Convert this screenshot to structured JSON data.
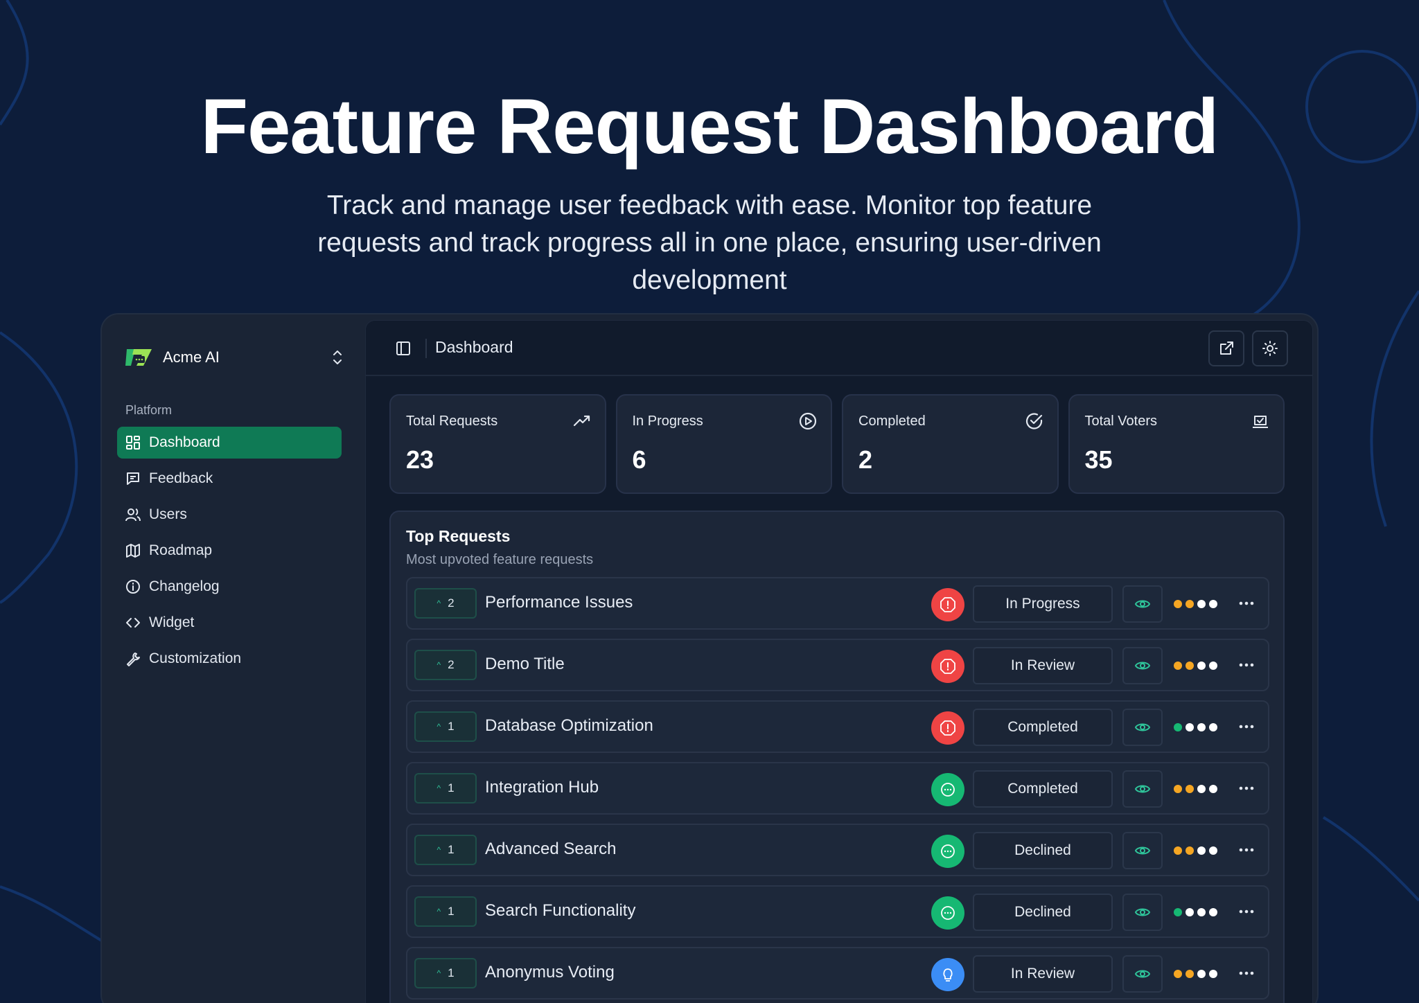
{
  "hero": {
    "title": "Feature Request Dashboard",
    "subtitle": "Track and manage user feedback with ease. Monitor top feature requests and track progress all in one place, ensuring user-driven development"
  },
  "colors": {
    "background": "#0d1d3a",
    "accent_green": "#0f7a55",
    "red": "#ef4444",
    "green": "#16b873",
    "blue": "#3b8df5",
    "amber": "#f5a623"
  },
  "sidebar": {
    "brand": "Acme AI",
    "section": "Platform",
    "items": [
      {
        "label": "Dashboard",
        "icon": "layout-dashboard-icon",
        "active": true
      },
      {
        "label": "Feedback",
        "icon": "message-square-icon",
        "active": false
      },
      {
        "label": "Users",
        "icon": "users-icon",
        "active": false
      },
      {
        "label": "Roadmap",
        "icon": "map-icon",
        "active": false
      },
      {
        "label": "Changelog",
        "icon": "info-icon",
        "active": false
      },
      {
        "label": "Widget",
        "icon": "code-icon",
        "active": false
      },
      {
        "label": "Customization",
        "icon": "wrench-icon",
        "active": false
      }
    ]
  },
  "topbar": {
    "title": "Dashboard"
  },
  "stats": [
    {
      "label": "Total Requests",
      "value": "23",
      "icon": "trending-up-icon"
    },
    {
      "label": "In Progress",
      "value": "6",
      "icon": "play-circle-icon"
    },
    {
      "label": "Completed",
      "value": "2",
      "icon": "check-circle-icon"
    },
    {
      "label": "Total Voters",
      "value": "35",
      "icon": "vote-icon"
    }
  ],
  "panel": {
    "title": "Top Requests",
    "subtitle": "Most upvoted feature requests",
    "rows": [
      {
        "votes": "2",
        "title": "Performance Issues",
        "category": "bug",
        "status": "In Progress",
        "priority": "amber"
      },
      {
        "votes": "2",
        "title": "Demo Title",
        "category": "bug",
        "status": "In Review",
        "priority": "amber"
      },
      {
        "votes": "1",
        "title": "Database Optimization",
        "category": "bug",
        "status": "Completed",
        "priority": "green"
      },
      {
        "votes": "1",
        "title": "Integration Hub",
        "category": "general",
        "status": "Completed",
        "priority": "amber"
      },
      {
        "votes": "1",
        "title": "Advanced Search",
        "category": "general",
        "status": "Declined",
        "priority": "amber"
      },
      {
        "votes": "1",
        "title": "Search Functionality",
        "category": "general",
        "status": "Declined",
        "priority": "green"
      },
      {
        "votes": "1",
        "title": "Anonymus Voting",
        "category": "idea",
        "status": "In Review",
        "priority": "amber"
      }
    ]
  }
}
